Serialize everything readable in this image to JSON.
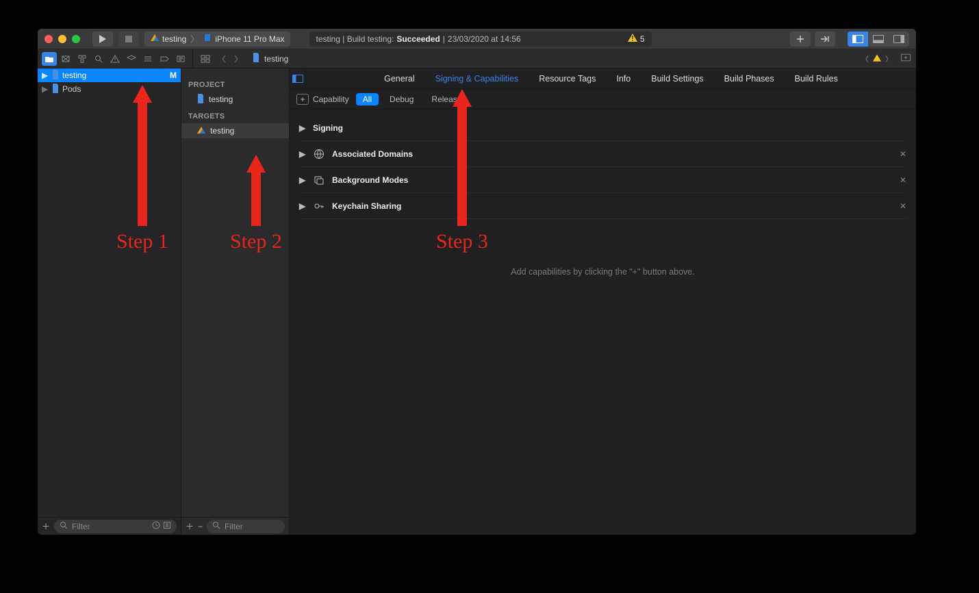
{
  "titlebar": {
    "scheme_name": "testing",
    "device": "iPhone 11 Pro Max",
    "activity_prefix": "testing | Build testing: ",
    "activity_status": "Succeeded",
    "activity_sep": " | ",
    "activity_time": "23/03/2020 at 14:56",
    "warn_count": "5"
  },
  "path": {
    "file": "testing"
  },
  "navigator": {
    "items": [
      {
        "name": "testing",
        "badge": "M",
        "selected": true
      },
      {
        "name": "Pods",
        "badge": "",
        "selected": false
      }
    ],
    "filter_placeholder": "Filter"
  },
  "targets": {
    "project_heading": "PROJECT",
    "project_name": "testing",
    "targets_heading": "TARGETS",
    "target_name": "testing",
    "filter_placeholder": "Filter"
  },
  "editor": {
    "tabs": [
      "General",
      "Signing & Capabilities",
      "Resource Tags",
      "Info",
      "Build Settings",
      "Build Phases",
      "Build Rules"
    ],
    "active_tab_index": 1,
    "cap_add_label": "Capability",
    "configs": [
      "All",
      "Debug",
      "Release"
    ],
    "active_config_index": 0,
    "capabilities": [
      {
        "label": "Signing",
        "icon": "",
        "removable": false
      },
      {
        "label": "Associated Domains",
        "icon": "globe",
        "removable": true
      },
      {
        "label": "Background Modes",
        "icon": "bg",
        "removable": true
      },
      {
        "label": "Keychain Sharing",
        "icon": "key",
        "removable": true
      }
    ],
    "hint": "Add capabilities by clicking the \"+\" button above."
  },
  "annotations": {
    "step1": "Step 1",
    "step2": "Step 2",
    "step3": "Step 3"
  }
}
